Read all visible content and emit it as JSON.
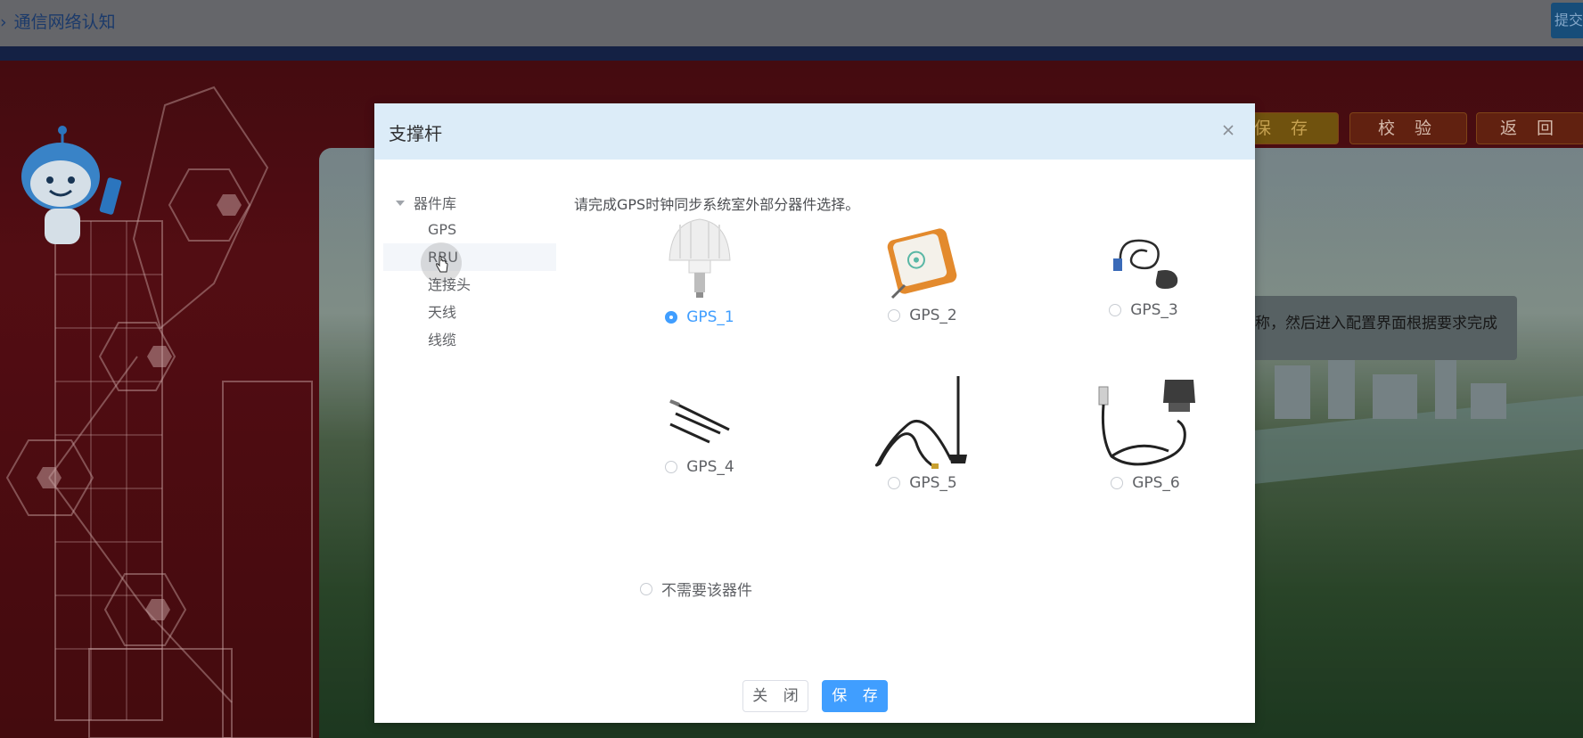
{
  "top_bar": {
    "breadcrumb": "通信网络认知",
    "submit_button": "提交"
  },
  "background_page": {
    "buttons": {
      "save": "保 存",
      "verify": "校 验",
      "back": "返 回"
    },
    "tooltip_text": "称，然后进入配置界面根据要求完成"
  },
  "modal": {
    "title": "支撑杆",
    "tree": {
      "root": "器件库",
      "items": [
        {
          "label": "GPS"
        },
        {
          "label": "RRU"
        },
        {
          "label": "连接头"
        },
        {
          "label": "天线"
        },
        {
          "label": "线缆"
        }
      ]
    },
    "instruction": "请完成GPS时钟同步系统室外部分器件选择。",
    "options": [
      {
        "label": "GPS_1",
        "selected": true
      },
      {
        "label": "GPS_2",
        "selected": false
      },
      {
        "label": "GPS_3",
        "selected": false
      },
      {
        "label": "GPS_4",
        "selected": false
      },
      {
        "label": "GPS_5",
        "selected": false
      },
      {
        "label": "GPS_6",
        "selected": false
      }
    ],
    "none_option": "不需要该器件",
    "footer": {
      "close": "关 闭",
      "save": "保 存"
    }
  },
  "colors": {
    "accent": "#409eff",
    "modal_header": "#dcecf8",
    "background_red": "#5a0f15"
  }
}
